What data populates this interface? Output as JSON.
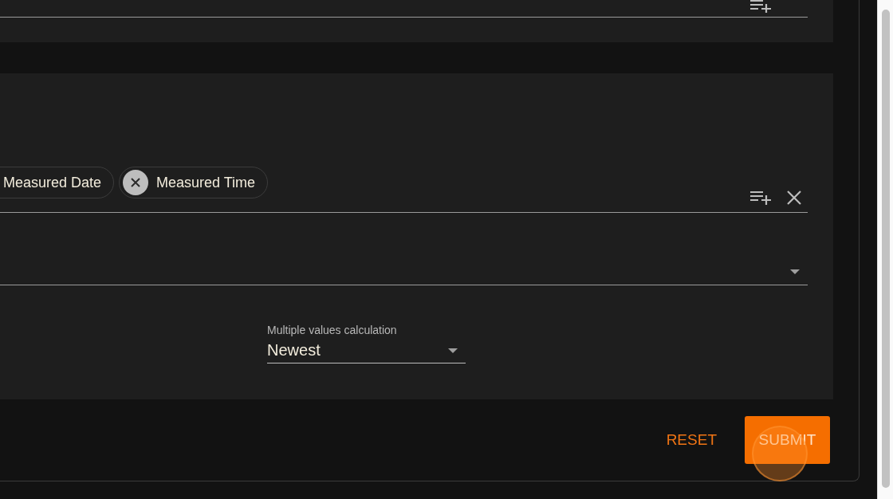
{
  "chips_field": {
    "chips": [
      {
        "label": "Measured Date",
        "cut_left": true
      },
      {
        "label": "Measured Time",
        "cut_left": false
      }
    ]
  },
  "calculation": {
    "label": "Multiple values calculation",
    "value": "Newest"
  },
  "buttons": [
    {
      "label": "RESET",
      "kind": "text",
      "pressed": false
    },
    {
      "label": "SUBMIT",
      "kind": "filled",
      "pressed": true
    }
  ]
}
